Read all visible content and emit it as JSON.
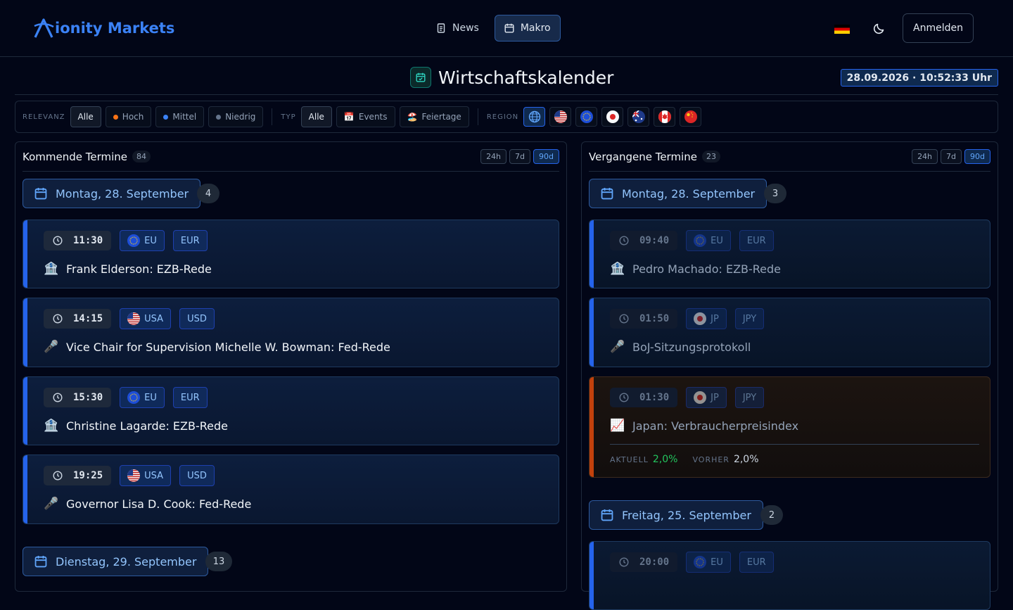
{
  "brand": {
    "name": "ionity Markets",
    "accent": "#3b82f6"
  },
  "nav": {
    "news": "News",
    "makro": "Makro",
    "active": "Makro"
  },
  "header": {
    "language_flag": "de",
    "login": "Anmelden"
  },
  "page": {
    "title": "Wirtschaftskalender",
    "clock": "28.09.2026 · 10:52:33 Uhr"
  },
  "filters": {
    "relevance_label": "RELEVANZ",
    "relevance": [
      {
        "label": "Alle",
        "active": true,
        "color": ""
      },
      {
        "label": "Hoch",
        "active": false,
        "color": "#f97316"
      },
      {
        "label": "Mittel",
        "active": false,
        "color": "#3b82f6"
      },
      {
        "label": "Niedrig",
        "active": false,
        "color": "#64748b"
      }
    ],
    "type_label": "TYP",
    "types": [
      {
        "label": "Alle",
        "icon": "",
        "active": true
      },
      {
        "label": "Events",
        "icon": "📅",
        "active": false
      },
      {
        "label": "Feiertage",
        "icon": "🏖️",
        "active": false
      }
    ],
    "region_label": "REGION",
    "regions": [
      "global",
      "us",
      "eu",
      "jp",
      "au",
      "ca",
      "cn"
    ],
    "active_region": "global"
  },
  "upcoming": {
    "title": "Kommende Termine",
    "count": "84",
    "ranges": [
      "24h",
      "7d",
      "90d"
    ],
    "active_range": "90d",
    "groups": [
      {
        "day": "Montag, 28. September",
        "count": "4",
        "events": [
          {
            "time": "11:30",
            "region": "EU",
            "flag": "eu",
            "currency": "EUR",
            "icon": "🏦",
            "title": "Frank Elderson: EZB-Rede"
          },
          {
            "time": "14:15",
            "region": "USA",
            "flag": "us",
            "currency": "USD",
            "icon": "🎤",
            "title": "Vice Chair for Supervision Michelle W. Bowman: Fed-Rede"
          },
          {
            "time": "15:30",
            "region": "EU",
            "flag": "eu",
            "currency": "EUR",
            "icon": "🏦",
            "title": "Christine Lagarde: EZB-Rede"
          },
          {
            "time": "19:25",
            "region": "USA",
            "flag": "us",
            "currency": "USD",
            "icon": "🎤",
            "title": "Governor Lisa D. Cook: Fed-Rede"
          }
        ]
      },
      {
        "day": "Dienstag, 29. September",
        "count": "13",
        "events": []
      }
    ]
  },
  "past": {
    "title": "Vergangene Termine",
    "count": "23",
    "ranges": [
      "24h",
      "7d",
      "90d"
    ],
    "active_range": "90d",
    "groups": [
      {
        "day": "Montag, 28. September",
        "count": "3",
        "events": [
          {
            "time": "09:40",
            "region": "EU",
            "flag": "eu",
            "currency": "EUR",
            "icon": "🏦",
            "title": "Pedro Machado: EZB-Rede"
          },
          {
            "time": "01:50",
            "region": "JP",
            "flag": "jp",
            "currency": "JPY",
            "icon": "🎤",
            "title": "BoJ-Sitzungsprotokoll"
          },
          {
            "time": "01:30",
            "region": "JP",
            "flag": "jp",
            "currency": "JPY",
            "icon": "📈",
            "title": "Japan: Verbraucherpreisindex",
            "actual_label": "AKTUELL",
            "actual": "2,0%",
            "previous_label": "VORHER",
            "previous": "2,0%"
          }
        ]
      },
      {
        "day": "Freitag, 25. September",
        "count": "2",
        "events": [
          {
            "time": "20:00",
            "region": "EU",
            "flag": "eu",
            "currency": "EUR",
            "icon": "",
            "title": ""
          }
        ]
      }
    ]
  }
}
